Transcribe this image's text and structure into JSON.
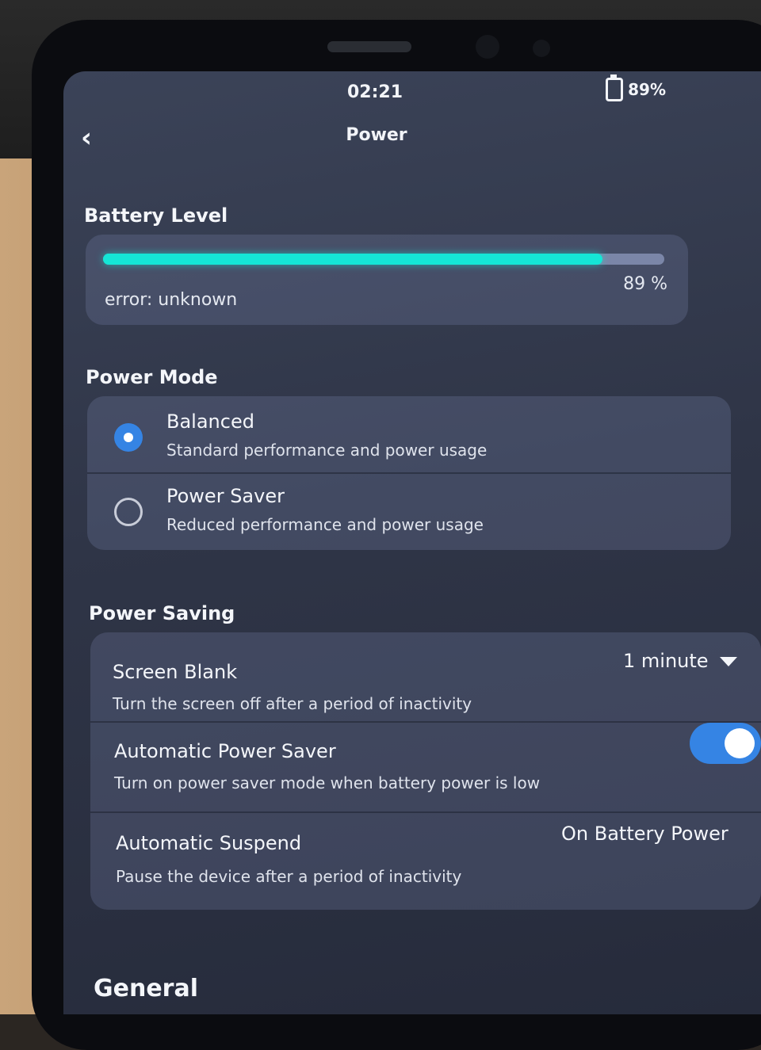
{
  "status_bar": {
    "time": "02:21",
    "battery": "89%"
  },
  "header": {
    "title": "Power"
  },
  "battery_section": {
    "title": "Battery Level",
    "level_percent": 89,
    "percent_label": "89 %",
    "error_text": "error: unknown"
  },
  "power_mode": {
    "title": "Power Mode",
    "options": [
      {
        "label": "Balanced",
        "description": "Standard performance and power usage",
        "selected": true
      },
      {
        "label": "Power Saver",
        "description": "Reduced performance and power usage",
        "selected": false
      }
    ]
  },
  "power_saving": {
    "title": "Power Saving",
    "rows": [
      {
        "title": "Screen Blank",
        "description": "Turn the screen off after a period of inactivity",
        "value": "1 minute"
      },
      {
        "title": "Automatic Power Saver",
        "description": "Turn on power saver mode when battery power is low",
        "toggle_on": true
      },
      {
        "title": "Automatic Suspend",
        "description": "Pause the device after a period of inactivity",
        "value": "On Battery Power"
      }
    ]
  },
  "general": {
    "title": "General"
  },
  "colors": {
    "accent": "#3584e4",
    "progress": "#15e6d6"
  }
}
